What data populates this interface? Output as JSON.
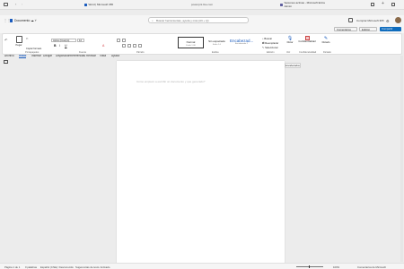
{
  "browser": {
    "address": "powerpnt.live.com",
    "tabs": [
      "Word | Microsoft 365",
      "Sesiones activas - Microsoft Entra Admin"
    ]
  },
  "word": {
    "doc_name": "Documento",
    "search_placeholder": "Buscar herramientas, ayuda y más (Alt + Q)",
    "comprar_label": "Comprar Microsoft 365",
    "comments_label": "Comentarios",
    "edit_label": "Edición",
    "share_label": "Compartir",
    "menus": [
      "Archivo",
      "Inicio",
      "Insertar",
      "Dibujar",
      "Disposición",
      "Referencias",
      "Revisar",
      "Vista",
      "Ayuda"
    ],
    "font_name": "Aptos (Cuerpo)",
    "font_size": "12",
    "paste_label": "Pegar",
    "clipboard_label": "Portapapeles",
    "copy_format_label": "Copiar formato",
    "group_font": "Fuente",
    "group_paragraph": "Párrafo",
    "group_styles": "Estilos",
    "group_edit": "Edición",
    "group_voice": "Voz",
    "group_sensitivity": "Confidencialidad",
    "group_dictate": "Dictado",
    "styles": [
      "Normal",
      "Sin espaciado",
      "Encabezad..."
    ],
    "style_meta": [
      "Estilo 1.08",
      "Estilo 1.0",
      "Encabezado 1"
    ],
    "find_label": "Buscar",
    "replace_label": "Reemplazar",
    "select_label": "Seleccionar",
    "voice_label": "Dictar",
    "sensitivity_label": "Confidencialidad",
    "dictate_label": "Dictado",
    "editor_button": "Encabezados",
    "doc_placeholder": "Cómo empiezo a escribir un documento y que generado?",
    "status": [
      "Página 1 de 1",
      "0 palabras",
      "Español (Chile): Desconocido",
      "Sugerencias de texto: Activado"
    ],
    "zoom": "100%",
    "feedback": "Comentarios de Microsoft",
    "colors": {
      "accent": "#0f6cbd",
      "brand": "#185abd"
    }
  }
}
